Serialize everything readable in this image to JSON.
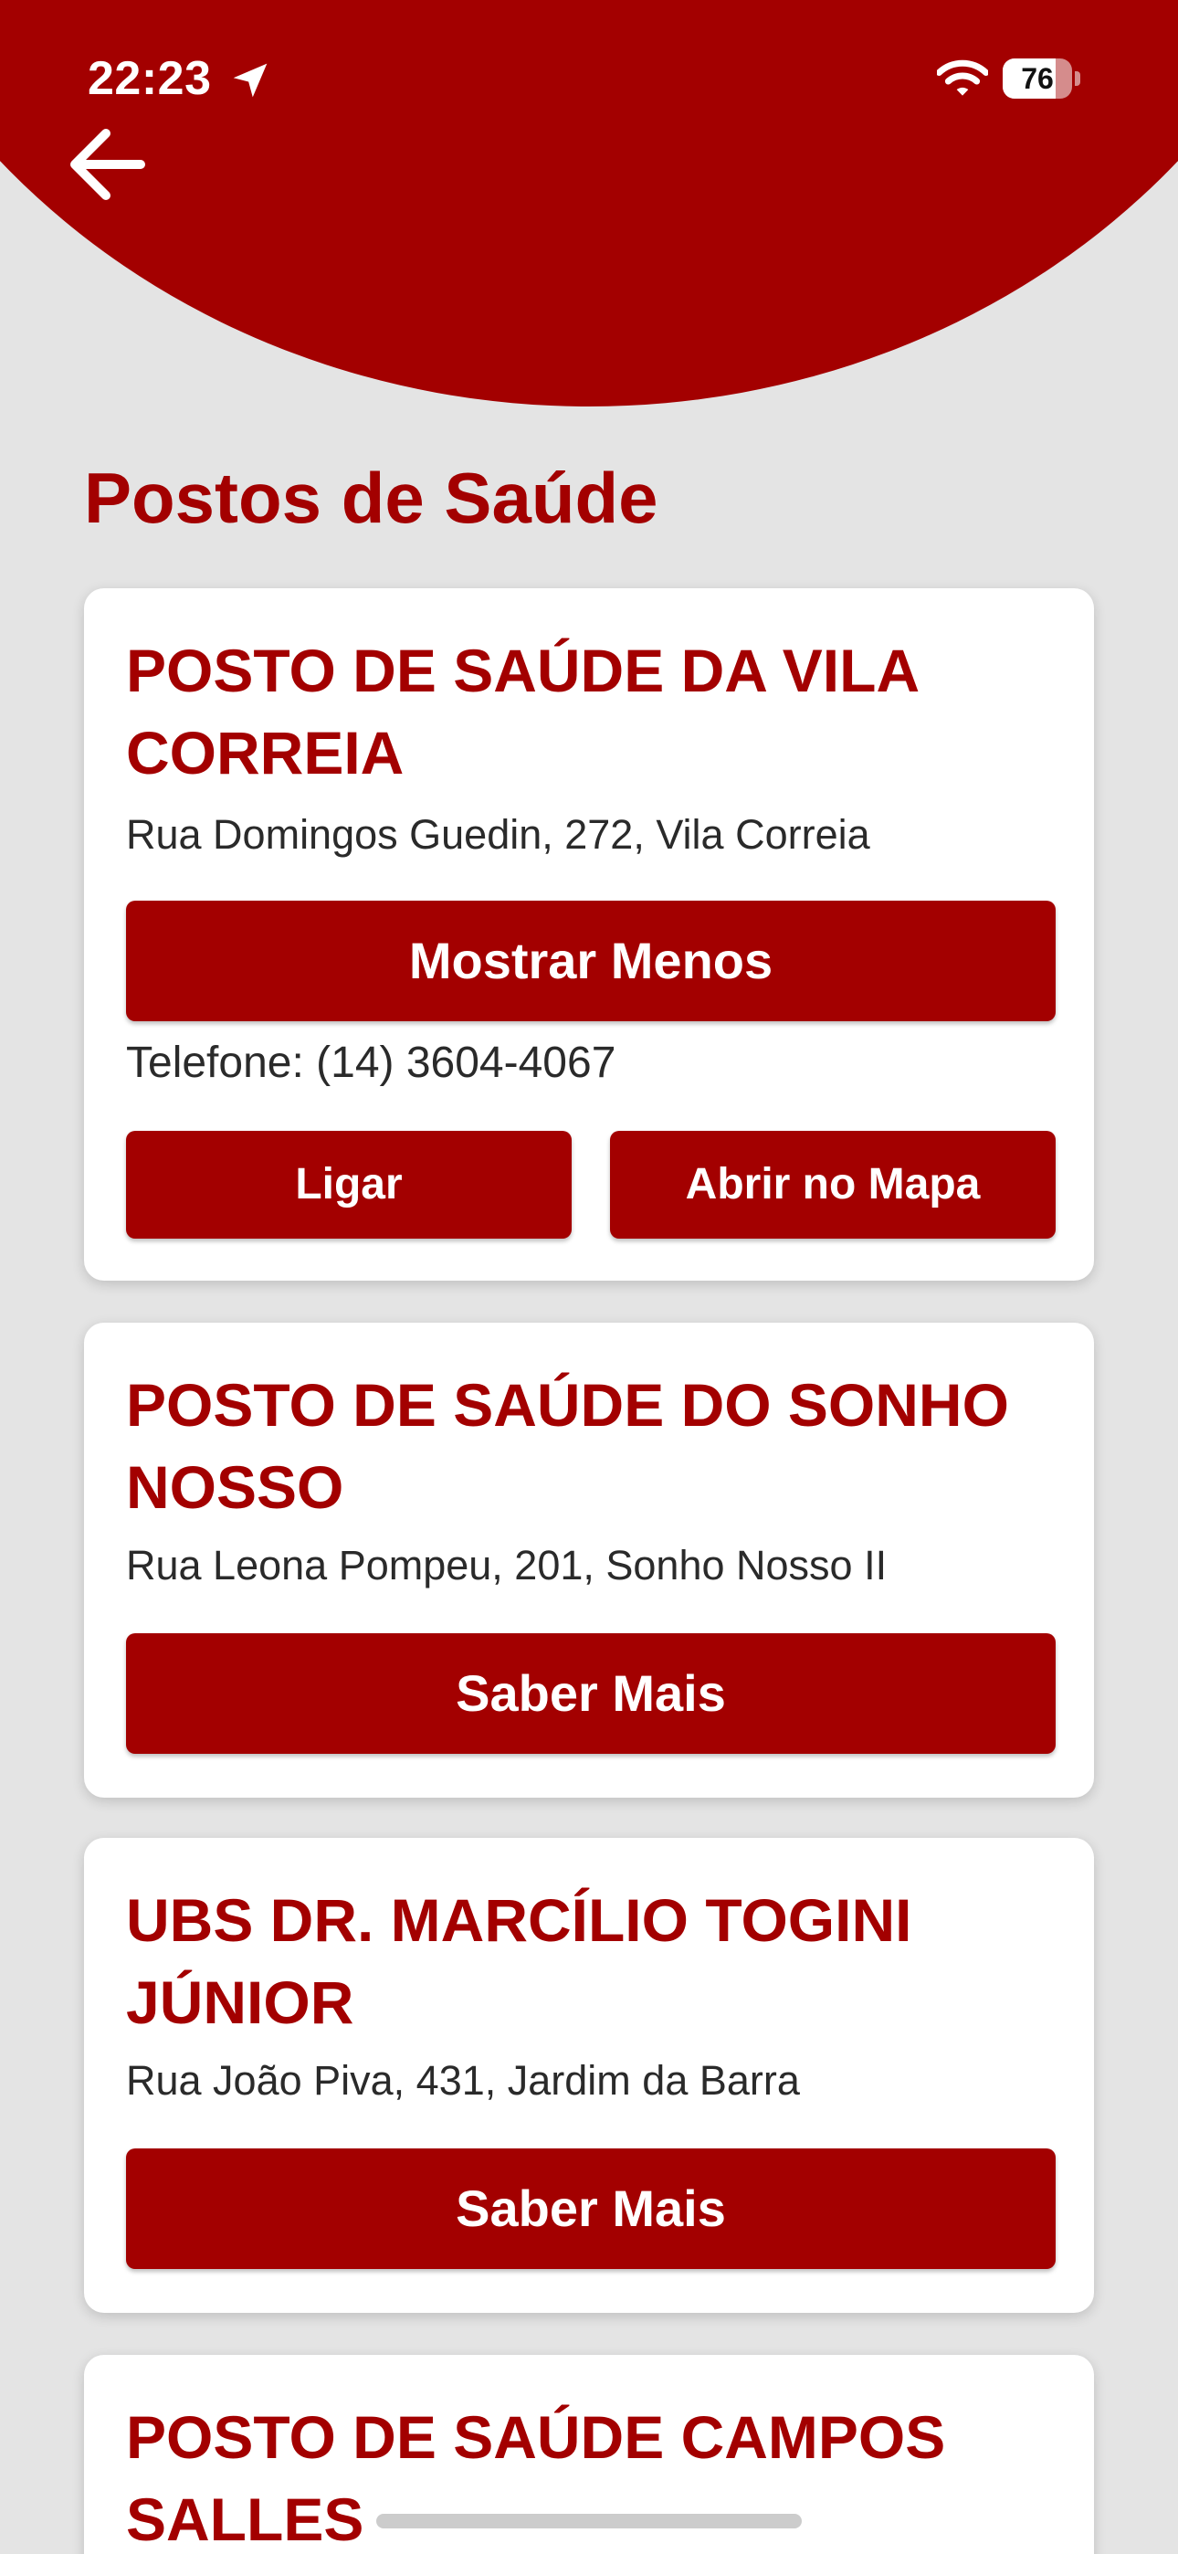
{
  "status_bar": {
    "time": "22:23",
    "battery_level": "76",
    "battery_fraction": 0.76,
    "icons": [
      "location-arrow-icon",
      "wifi-icon",
      "battery-icon"
    ]
  },
  "header": {
    "back_icon": "arrow-left-icon",
    "accent_color": "#a30000"
  },
  "page": {
    "title": "Postos de Saúde"
  },
  "cards": [
    {
      "name": "POSTO DE SAÚDE DA VILA CORREIA",
      "address": "Rua Domingos Guedin, 272, Vila Correia",
      "toggle_label": "Mostrar Menos",
      "expanded": true,
      "phone": "Telefone: (14) 3604-4067",
      "call_label": "Ligar",
      "map_label": "Abrir no Mapa"
    },
    {
      "name": "POSTO DE SAÚDE DO SONHO NOSSO",
      "address": "Rua Leona Pompeu, 201, Sonho Nosso II",
      "toggle_label": "Saber Mais",
      "expanded": false
    },
    {
      "name": "UBS DR. MARCÍLIO TOGINI JÚNIOR",
      "address": "Rua João Piva, 431, Jardim da Barra",
      "toggle_label": "Saber Mais",
      "expanded": false
    },
    {
      "name": "POSTO DE SAÚDE CAMPOS SALLES"
    }
  ]
}
